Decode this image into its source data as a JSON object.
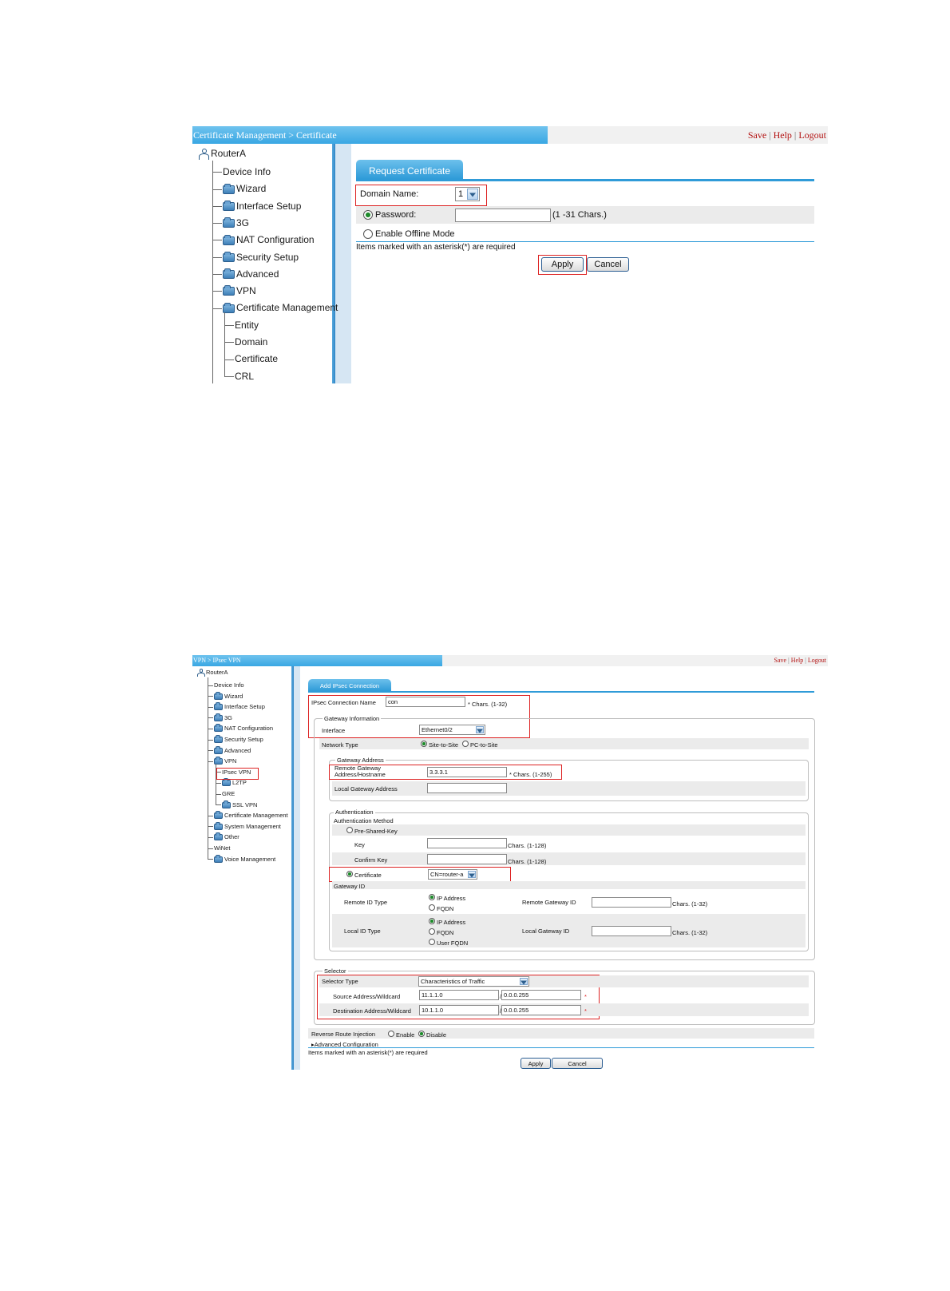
{
  "shot1": {
    "breadcrumb": "Certificate Management > Certificate",
    "links": {
      "save": "Save",
      "help": "Help",
      "logout": "Logout"
    },
    "tree_root": "RouterA",
    "tree": [
      {
        "label": "Device Info",
        "type": "leaf"
      },
      {
        "label": "Wizard",
        "type": "folder"
      },
      {
        "label": "Interface Setup",
        "type": "folder"
      },
      {
        "label": "3G",
        "type": "folder"
      },
      {
        "label": "NAT Configuration",
        "type": "folder"
      },
      {
        "label": "Security Setup",
        "type": "folder"
      },
      {
        "label": "Advanced",
        "type": "folder"
      },
      {
        "label": "VPN",
        "type": "folder"
      },
      {
        "label": "Certificate Management",
        "type": "folder"
      },
      {
        "label": "Entity",
        "type": "child"
      },
      {
        "label": "Domain",
        "type": "child"
      },
      {
        "label": "Certificate",
        "type": "child"
      },
      {
        "label": "CRL",
        "type": "child"
      }
    ],
    "tab": "Request Certificate",
    "domain_label": "Domain Name:",
    "domain_value": "1",
    "password_label": "Password:",
    "password_value": "",
    "password_hint": "(1 -31 Chars.)",
    "offline_label": "Enable Offline Mode",
    "required_note": "Items marked with an asterisk(*) are required",
    "apply": "Apply",
    "cancel": "Cancel"
  },
  "shot2": {
    "breadcrumb": "VPN > IPsec VPN",
    "links": {
      "save": "Save",
      "help": "Help",
      "logout": "Logout"
    },
    "tree_root": "RouterA",
    "tree": [
      {
        "label": "Device Info",
        "type": "leaf"
      },
      {
        "label": "Wizard",
        "type": "folder"
      },
      {
        "label": "Interface Setup",
        "type": "folder"
      },
      {
        "label": "3G",
        "type": "folder"
      },
      {
        "label": "NAT Configuration",
        "type": "folder"
      },
      {
        "label": "Security Setup",
        "type": "folder"
      },
      {
        "label": "Advanced",
        "type": "folder"
      },
      {
        "label": "VPN",
        "type": "folder"
      },
      {
        "label": "IPsec VPN",
        "type": "child-leaf"
      },
      {
        "label": "L2TP",
        "type": "child-folder"
      },
      {
        "label": "GRE",
        "type": "child-leaf"
      },
      {
        "label": "SSL VPN",
        "type": "child-folder"
      },
      {
        "label": "Certificate Management",
        "type": "folder"
      },
      {
        "label": "System Management",
        "type": "folder"
      },
      {
        "label": "Other",
        "type": "folder"
      },
      {
        "label": "WiNet",
        "type": "leaf"
      },
      {
        "label": "Voice Management",
        "type": "folder"
      }
    ],
    "tab": "Add IPsec Connection",
    "conn_name_label": "IPsec Connection Name",
    "conn_name_value": "con",
    "conn_name_hint": "* Chars. (1-32)",
    "gateway_info_legend": "Gateway Information",
    "interface_label": "Interface",
    "interface_value": "Ethernet0/2",
    "network_type_label": "Network Type",
    "site_to_site": "Site-to-Site",
    "pc_to_site": "PC-to-Site",
    "gateway_address_legend": "Gateway Address",
    "remote_gw_label_1": "Remote Gateway",
    "remote_gw_label_2": "Address/Hostname",
    "remote_gw_value": "3.3.3.1",
    "remote_gw_hint": "* Chars. (1-255)",
    "local_gw_label": "Local Gateway Address",
    "local_gw_value": "",
    "auth_legend": "Authentication",
    "auth_method_label": "Authentication Method",
    "psk_label": "Pre-Shared-Key",
    "key_label": "Key",
    "key_hint": "Chars. (1-128)",
    "confirm_key_label": "Confirm Key",
    "confirm_key_hint": "Chars. (1-128)",
    "certificate_label": "Certificate",
    "certificate_value": "CN=router-a",
    "gateway_id_label": "Gateway ID",
    "remote_id_type_label": "Remote ID Type",
    "remote_id_opts": [
      "IP Address",
      "FQDN"
    ],
    "remote_gw_id_label": "Remote Gateway ID",
    "remote_gw_id_hint": "Chars. (1-32)",
    "local_id_type_label": "Local ID Type",
    "local_id_opts": [
      "IP Address",
      "FQDN",
      "User FQDN"
    ],
    "local_gw_id_label": "Local Gateway ID",
    "local_gw_id_hint": "Chars. (1-32)",
    "selector_legend": "Selector",
    "selector_type_label": "Selector Type",
    "selector_type_value": "Characteristics of Traffic",
    "source_label": "Source Address/Wildcard",
    "source_addr": "11.1.1.0",
    "source_wild": "0.0.0.255",
    "dest_label": "Destination Address/Wildcard",
    "dest_addr": "10.1.1.0",
    "dest_wild": "0.0.0.255",
    "slash": "/",
    "asterisk": "*",
    "rri_label": "Reverse Route Injection",
    "enable": "Enable",
    "disable": "Disable",
    "adv_config": "Advanced Configuration",
    "required_note": "Items marked with an asterisk(*) are required",
    "apply": "Apply",
    "cancel": "Cancel"
  }
}
